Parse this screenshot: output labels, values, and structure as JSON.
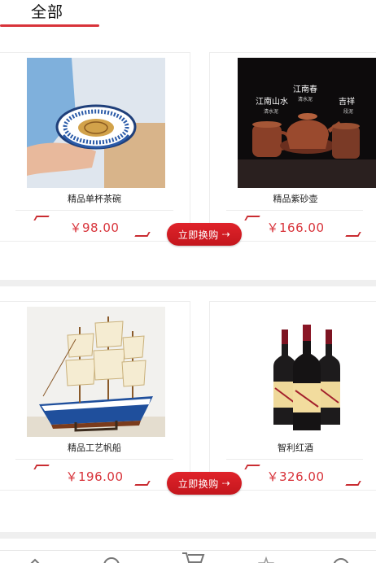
{
  "tabs": {
    "active_label": "全部"
  },
  "products": [
    {
      "name": "精品单杯茶碗",
      "price": "￥98.00"
    },
    {
      "name": "精品紫砂壶",
      "price": "￥166.00"
    },
    {
      "name": "精品工艺帆船",
      "price": "￥196.00"
    },
    {
      "name": "智利红酒",
      "price": "￥326.00"
    }
  ],
  "cta": {
    "label": "立即换购"
  },
  "teapot_image_text": {
    "left": "江南山水",
    "left_sub": "清水泥",
    "center": "江南春",
    "center_sub": "清水泥",
    "right": "吉祥",
    "right_sub": "段泥"
  },
  "bottom_nav": {
    "icons": [
      "home-icon",
      "category-icon",
      "cart-icon",
      "star-icon",
      "profile-icon"
    ]
  },
  "colors": {
    "accent": "#d8333a",
    "price": "#d8333a",
    "cta": "#d0191f"
  }
}
